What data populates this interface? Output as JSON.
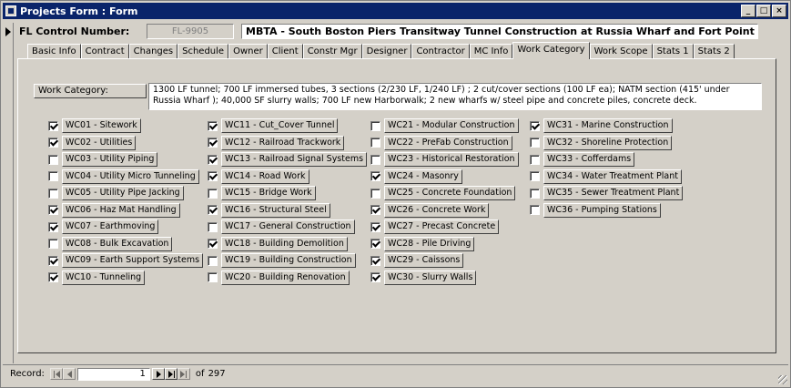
{
  "window": {
    "title": "Projects Form : Form",
    "buttons": {
      "minimize": "_",
      "maximize": "□",
      "close": "×"
    }
  },
  "header": {
    "fl_label": "FL Control Number:",
    "fl_number": "FL-9905",
    "project_title": "MBTA - South Boston Piers Transitway Tunnel Construction at Russia Wharf and Fort Point Channel"
  },
  "tabs": [
    {
      "label": "Basic Info",
      "active": false
    },
    {
      "label": "Contract",
      "active": false
    },
    {
      "label": "Changes",
      "active": false
    },
    {
      "label": "Schedule",
      "active": false
    },
    {
      "label": "Owner",
      "active": false
    },
    {
      "label": "Client",
      "active": false
    },
    {
      "label": "Constr Mgr",
      "active": false
    },
    {
      "label": "Designer",
      "active": false
    },
    {
      "label": "Contractor",
      "active": false
    },
    {
      "label": "MC Info",
      "active": false
    },
    {
      "label": "Work Category",
      "active": true
    },
    {
      "label": "Work Scope",
      "active": false
    },
    {
      "label": "Stats 1",
      "active": false
    },
    {
      "label": "Stats 2",
      "active": false
    }
  ],
  "work_category": {
    "label": "Work Category:",
    "description": "1300 LF tunnel; 700 LF immersed tubes, 3 sections (2/230 LF, 1/240 LF) ; 2 cut/cover sections (100 LF ea); NATM section (415' under Russia Wharf ); 40,000 SF slurry walls; 700 LF new Harborwalk; 2 new wharfs w/ steel pipe and concrete piles, concrete deck."
  },
  "checkboxes": [
    {
      "label": "WC01 - Sitework",
      "checked": true
    },
    {
      "label": "WC02 - Utilities",
      "checked": true
    },
    {
      "label": "WC03 - Utility Piping",
      "checked": false
    },
    {
      "label": "WC04 - Utility Micro Tunneling",
      "checked": false
    },
    {
      "label": "WC05 - Utility Pipe Jacking",
      "checked": false
    },
    {
      "label": "WC06 - Haz Mat Handling",
      "checked": true
    },
    {
      "label": "WC07 - Earthmoving",
      "checked": true
    },
    {
      "label": "WC08 - Bulk Excavation",
      "checked": false
    },
    {
      "label": "WC09 - Earth Support Systems",
      "checked": true
    },
    {
      "label": "WC10 - Tunneling",
      "checked": true
    },
    {
      "label": "WC11 - Cut_Cover Tunnel",
      "checked": true
    },
    {
      "label": "WC12 - Railroad Trackwork",
      "checked": true
    },
    {
      "label": "WC13 - Railroad Signal Systems",
      "checked": true
    },
    {
      "label": "WC14 - Road Work",
      "checked": true
    },
    {
      "label": "WC15 - Bridge Work",
      "checked": false
    },
    {
      "label": "WC16 - Structural Steel",
      "checked": true
    },
    {
      "label": "WC17 - General Construction",
      "checked": false
    },
    {
      "label": "WC18 - Building Demolition",
      "checked": true
    },
    {
      "label": "WC19 - Building Construction",
      "checked": false
    },
    {
      "label": "WC20 - Building Renovation",
      "checked": false
    },
    {
      "label": "WC21 - Modular Construction",
      "checked": false
    },
    {
      "label": "WC22 - PreFab Construction",
      "checked": false
    },
    {
      "label": "WC23 - Historical Restoration",
      "checked": false
    },
    {
      "label": "WC24 - Masonry",
      "checked": true
    },
    {
      "label": "WC25 - Concrete Foundation",
      "checked": false
    },
    {
      "label": "WC26 - Concrete Work",
      "checked": true
    },
    {
      "label": "WC27 - Precast Concrete",
      "checked": true
    },
    {
      "label": "WC28 - Pile Driving",
      "checked": true
    },
    {
      "label": "WC29 - Caissons",
      "checked": true
    },
    {
      "label": "WC30 - Slurry Walls",
      "checked": true
    },
    {
      "label": "WC31 - Marine Construction",
      "checked": true
    },
    {
      "label": "WC32 - Shoreline Protection",
      "checked": false
    },
    {
      "label": "WC33 - Cofferdams",
      "checked": false
    },
    {
      "label": "WC34 - Water Treatment Plant",
      "checked": false
    },
    {
      "label": "WC35 - Sewer Treatment Plant",
      "checked": false
    },
    {
      "label": "WC36 - Pumping Stations",
      "checked": false
    }
  ],
  "navigation": {
    "record_label": "Record:",
    "current": "1",
    "of_label": "of",
    "total": "297"
  },
  "colors": {
    "titlebar": "#0a246a",
    "face": "#d4d0c8"
  }
}
